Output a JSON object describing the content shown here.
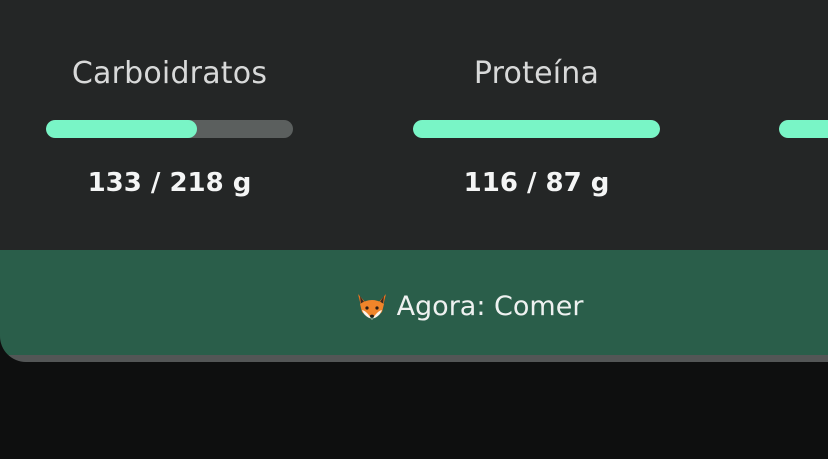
{
  "macros": [
    {
      "name": "Carboidratos",
      "value": "133 / 218 g",
      "progress": 0.61
    },
    {
      "name": "Proteína",
      "value": "116 / 87 g",
      "progress": 1.0
    },
    {
      "name": "",
      "value": "",
      "progress": 1.0
    }
  ],
  "footer": {
    "icon": "fox-icon",
    "text": "Agora: Comer"
  },
  "colors": {
    "card": "#242626",
    "bar_fill": "#79f5c6",
    "bar_track": "#5b5f5e",
    "footer": "#2a5e4a",
    "page": "#0e0f0f"
  }
}
